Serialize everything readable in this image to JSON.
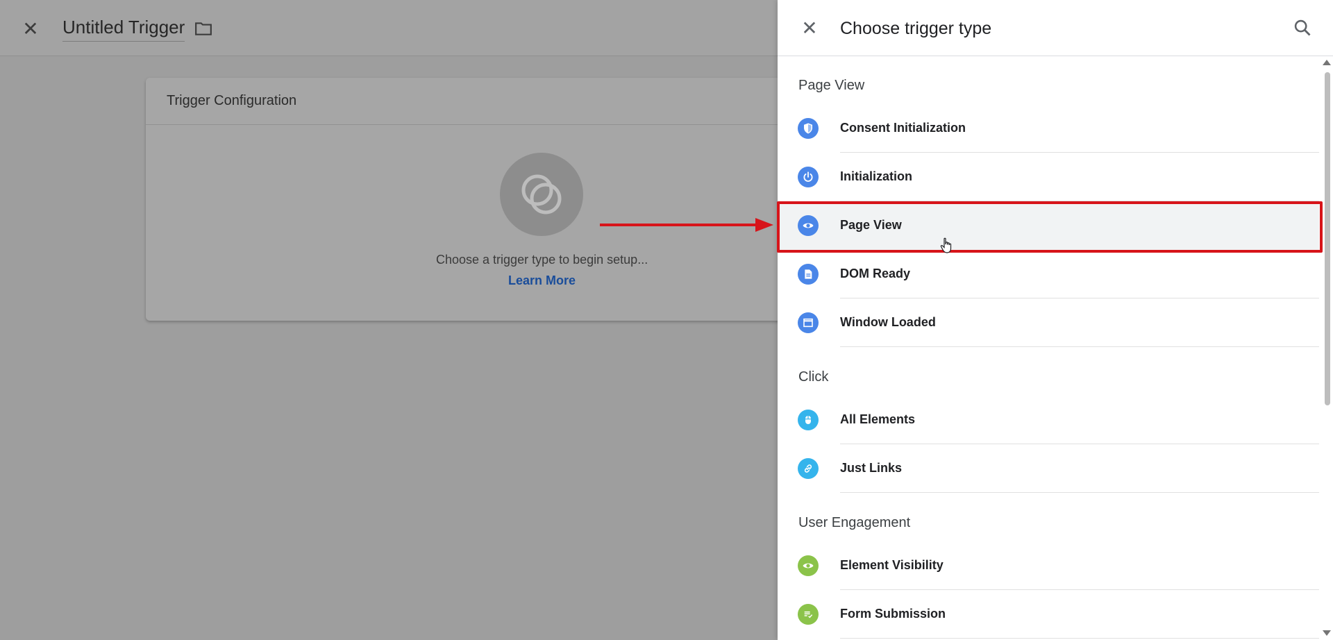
{
  "editor": {
    "title": "Untitled Trigger",
    "card_title": "Trigger Configuration",
    "choose_text": "Choose a trigger type to begin setup...",
    "learn_more": "Learn More"
  },
  "panel": {
    "title": "Choose trigger type",
    "sections": [
      {
        "label": "Page View",
        "items": [
          {
            "label": "Consent Initialization",
            "icon": "shield-icon",
            "color": "#4a86e8"
          },
          {
            "label": "Initialization",
            "icon": "power-icon",
            "color": "#4a86e8"
          },
          {
            "label": "Page View",
            "icon": "eye-icon",
            "color": "#4a86e8"
          },
          {
            "label": "DOM Ready",
            "icon": "document-icon",
            "color": "#4a86e8"
          },
          {
            "label": "Window Loaded",
            "icon": "window-icon",
            "color": "#4a86e8"
          }
        ]
      },
      {
        "label": "Click",
        "items": [
          {
            "label": "All Elements",
            "icon": "mouse-icon",
            "color": "#35b4ec"
          },
          {
            "label": "Just Links",
            "icon": "link-icon",
            "color": "#35b4ec"
          }
        ]
      },
      {
        "label": "User Engagement",
        "items": [
          {
            "label": "Element Visibility",
            "icon": "eye-icon",
            "color": "#8bc34a"
          },
          {
            "label": "Form Submission",
            "icon": "form-icon",
            "color": "#8bc34a"
          }
        ]
      }
    ]
  },
  "colors": {
    "highlight_border": "#d7141a",
    "arrow": "#d7141a"
  }
}
